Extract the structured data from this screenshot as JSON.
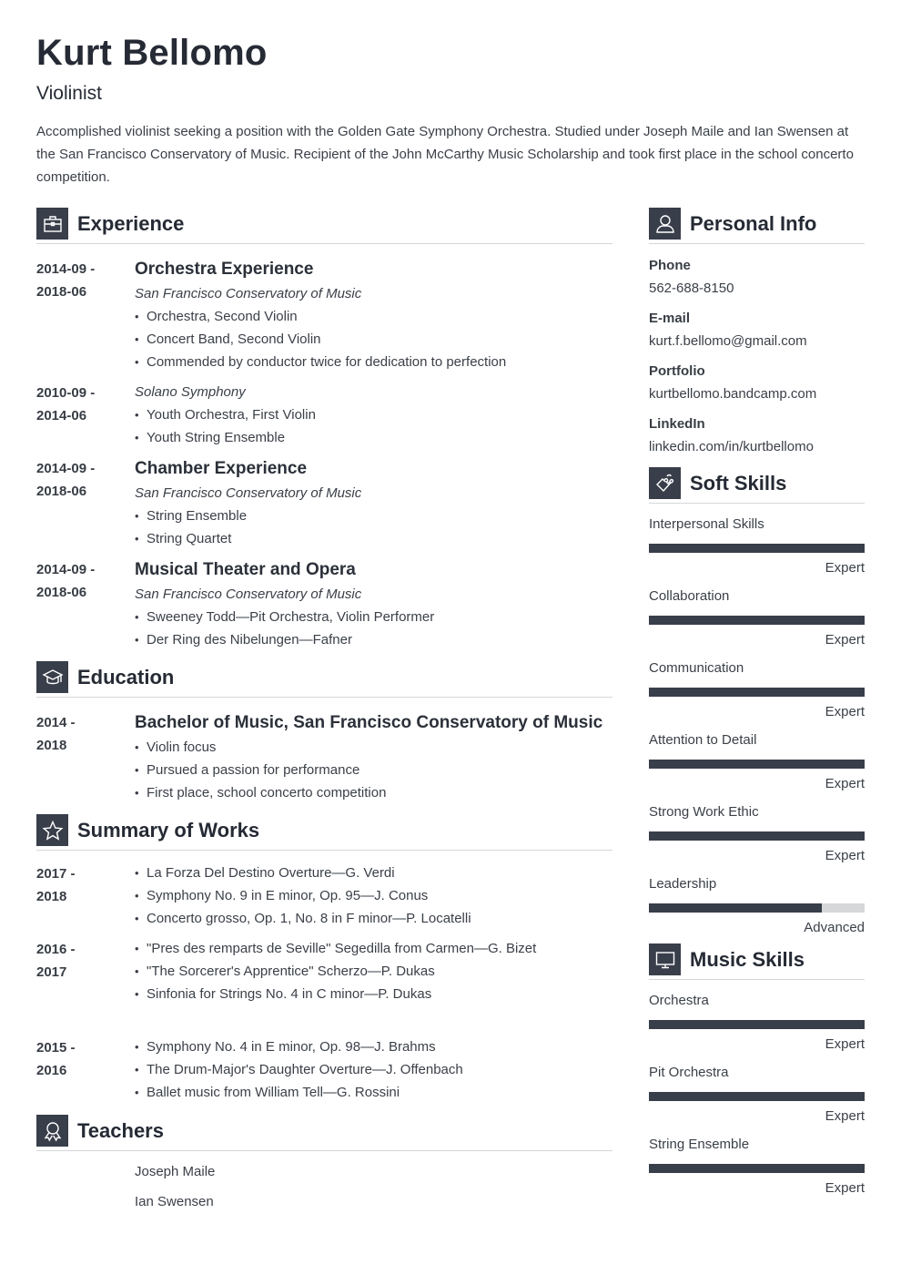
{
  "header": {
    "name": "Kurt Bellomo",
    "role": "Violinist",
    "summary": "Accomplished violinist seeking a position with the Golden Gate Symphony Orchestra. Studied under Joseph Maile and Ian Swensen at the San Francisco Conservatory of Music. Recipient of the John McCarthy Music Scholarship and took first place in the school concerto competition."
  },
  "experience": {
    "title": "Experience",
    "icon": "briefcase-icon",
    "entries": [
      {
        "date_start": "2014-09 -",
        "date_end": "2018-06",
        "title": "Orchestra Experience",
        "org": "San Francisco Conservatory of Music",
        "bullets": [
          "Orchestra, Second Violin",
          "Concert Band, Second Violin",
          "Commended by conductor twice for dedication to perfection"
        ]
      },
      {
        "date_start": "2010-09 -",
        "date_end": "2014-06",
        "title": "",
        "org": "Solano Symphony",
        "bullets": [
          "Youth Orchestra, First Violin",
          "Youth String Ensemble"
        ]
      },
      {
        "date_start": "2014-09 -",
        "date_end": "2018-06",
        "title": "Chamber Experience",
        "org": "San Francisco Conservatory of Music",
        "bullets": [
          "String Ensemble",
          "String Quartet"
        ]
      },
      {
        "date_start": "2014-09 -",
        "date_end": "2018-06",
        "title": "Musical Theater and Opera",
        "org": "San Francisco Conservatory of Music",
        "bullets": [
          "Sweeney Todd—Pit Orchestra, Violin Performer",
          "Der Ring des Nibelungen—Fafner"
        ]
      }
    ]
  },
  "education": {
    "title": "Education",
    "icon": "graduation-cap-icon",
    "entries": [
      {
        "date_start": "2014 -",
        "date_end": "2018",
        "title": "Bachelor of Music, San Francisco Conservatory of Music",
        "bullets": [
          "Violin focus",
          "Pursued a passion for performance",
          "First place, school concerto competition"
        ]
      }
    ]
  },
  "works": {
    "title": "Summary of Works",
    "icon": "star-icon",
    "entries": [
      {
        "date_start": "2017 -",
        "date_end": "2018",
        "bullets": [
          "La Forza Del Destino Overture—G. Verdi",
          "Symphony No. 9 in E minor, Op. 95—J. Conus",
          "Concerto grosso, Op. 1, No. 8 in F minor—P. Locatelli"
        ]
      },
      {
        "date_start": "2016 -",
        "date_end": "2017",
        "bullets": [
          "\"Pres des remparts de Seville\" Segedilla from Carmen—G. Bizet",
          "\"The Sorcerer's Apprentice\" Scherzo—P. Dukas",
          "Sinfonia for Strings No. 4 in C minor—P. Dukas"
        ]
      },
      {
        "date_start": "2015 -",
        "date_end": "2016",
        "bullets": [
          "Symphony No. 4 in E minor, Op. 98—J. Brahms",
          "The Drum-Major's Daughter Overture—J. Offenbach",
          "Ballet music from William Tell—G. Rossini"
        ]
      }
    ]
  },
  "teachers": {
    "title": "Teachers",
    "icon": "award-ribbon-icon",
    "names": [
      "Joseph Maile",
      "Ian Swensen"
    ]
  },
  "personal_info": {
    "title": "Personal Info",
    "icon": "user-icon",
    "items": [
      {
        "label": "Phone",
        "value": "562-688-8150"
      },
      {
        "label": "E-mail",
        "value": "kurt.f.bellomo@gmail.com"
      },
      {
        "label": "Portfolio",
        "value": "kurtbellomo.bandcamp.com"
      },
      {
        "label": "LinkedIn",
        "value": "linkedin.com/in/kurtbellomo"
      }
    ]
  },
  "soft_skills": {
    "title": "Soft Skills",
    "icon": "puzzle-piece-icon",
    "items": [
      {
        "name": "Interpersonal Skills",
        "level": "Expert",
        "fill": 1.0
      },
      {
        "name": "Collaboration",
        "level": "Expert",
        "fill": 1.0
      },
      {
        "name": "Communication",
        "level": "Expert",
        "fill": 1.0
      },
      {
        "name": "Attention to Detail",
        "level": "Expert",
        "fill": 1.0
      },
      {
        "name": "Strong Work Ethic",
        "level": "Expert",
        "fill": 1.0
      },
      {
        "name": "Leadership",
        "level": "Advanced",
        "fill": 0.8
      }
    ]
  },
  "music_skills": {
    "title": "Music Skills",
    "icon": "monitor-icon",
    "items": [
      {
        "name": "Orchestra",
        "level": "Expert",
        "fill": 1.0
      },
      {
        "name": "Pit Orchestra",
        "level": "Expert",
        "fill": 1.0
      },
      {
        "name": "String Ensemble",
        "level": "Expert",
        "fill": 1.0
      }
    ]
  }
}
